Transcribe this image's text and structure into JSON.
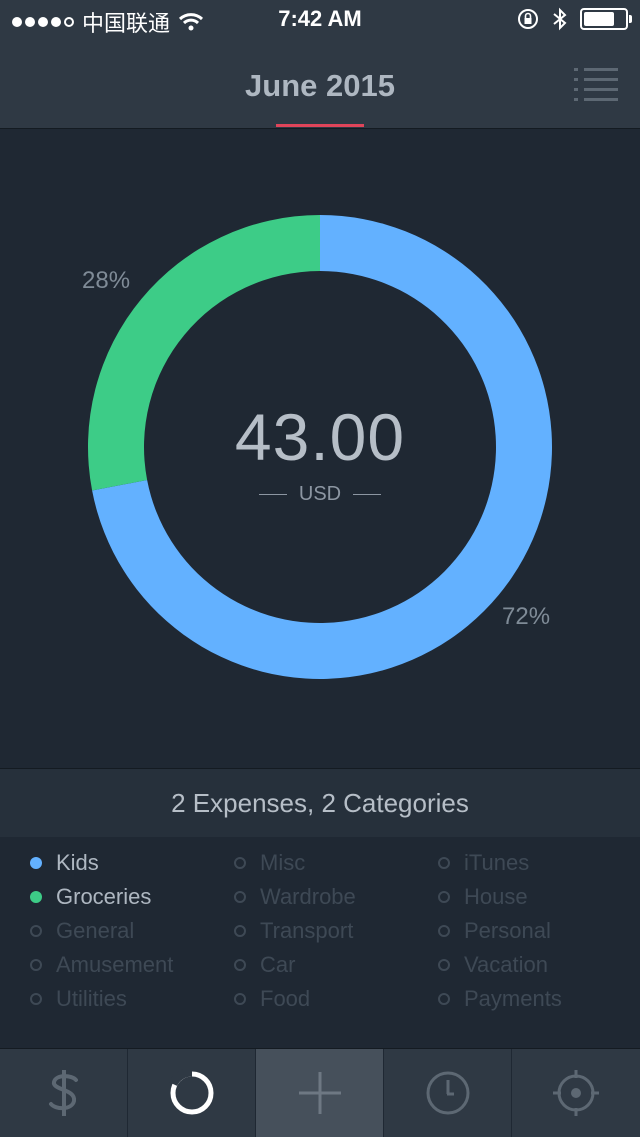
{
  "status_bar": {
    "carrier": "中国联通",
    "time": "7:42 AM"
  },
  "header": {
    "title": "June 2015",
    "accent_color": "#e0455a"
  },
  "chart_data": {
    "type": "pie",
    "labels": [
      "Kids",
      "Groceries"
    ],
    "values": [
      72,
      28
    ],
    "percent_labels": [
      "72%",
      "28%"
    ],
    "colors": [
      "#63b1ff",
      "#3dcc87"
    ],
    "center_value": "43.00",
    "center_unit": "USD"
  },
  "summary": {
    "text": "2 Expenses, 2 Categories"
  },
  "categories": [
    {
      "label": "Kids",
      "active": true,
      "color": "#63b1ff"
    },
    {
      "label": "Misc",
      "active": false
    },
    {
      "label": "iTunes",
      "active": false
    },
    {
      "label": "Groceries",
      "active": true,
      "color": "#3dcc87"
    },
    {
      "label": "Wardrobe",
      "active": false
    },
    {
      "label": "House",
      "active": false
    },
    {
      "label": "General",
      "active": false
    },
    {
      "label": "Transport",
      "active": false
    },
    {
      "label": "Personal",
      "active": false
    },
    {
      "label": "Amusement",
      "active": false
    },
    {
      "label": "Car",
      "active": false
    },
    {
      "label": "Vacation",
      "active": false
    },
    {
      "label": "Utilities",
      "active": false
    },
    {
      "label": "Food",
      "active": false
    },
    {
      "label": "Payments",
      "active": false
    }
  ],
  "tabs": [
    {
      "icon": "dollar-icon",
      "selected": false
    },
    {
      "icon": "donut-chart-icon",
      "selected": false
    },
    {
      "icon": "plus-icon",
      "selected": true
    },
    {
      "icon": "clock-icon",
      "selected": false
    },
    {
      "icon": "crosshair-icon",
      "selected": false
    }
  ]
}
